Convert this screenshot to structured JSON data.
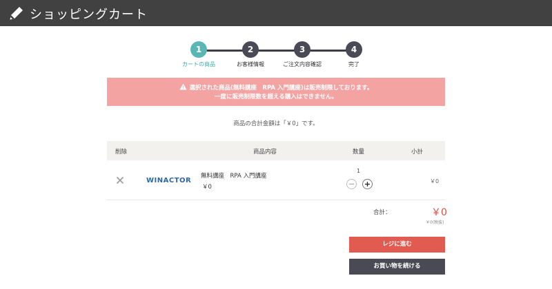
{
  "header": {
    "title": "ショッピングカート",
    "icon": "pencil-icon"
  },
  "steps": [
    {
      "num": "1",
      "label": "カートの商品",
      "active": true
    },
    {
      "num": "2",
      "label": "お客様情報",
      "active": false
    },
    {
      "num": "3",
      "label": "ご注文内容確認",
      "active": false
    },
    {
      "num": "4",
      "label": "完了",
      "active": false
    }
  ],
  "alert": {
    "line1": "選択された商品(無料講座　RPA 入門講座)は販売制限しております。",
    "line2": "一度に販売制限数を超える購入はできません。"
  },
  "summary": {
    "total_note": "商品の合計金額は「￥0」です。"
  },
  "cart": {
    "columns": {
      "remove": "削除",
      "item": "商品内容",
      "qty": "数量",
      "subtotal": "小計"
    },
    "items": [
      {
        "logo": "WINACTOR",
        "name": "無料講座　RPA 入門講座",
        "price": "￥0",
        "quantity": "1",
        "subtotal": "￥0"
      }
    ]
  },
  "totals": {
    "label": "合計：",
    "amount": "￥0",
    "tax_note": "￥0(税抜)"
  },
  "buttons": {
    "checkout": "レジに進む",
    "continue": "お買い物を続ける"
  },
  "colors": {
    "header_bg": "#414141",
    "accent_teal": "#59b6b2",
    "alert_bg": "#f4a3a3",
    "price_red": "#e04b3f",
    "checkout_bg": "#e15b50",
    "continue_bg": "#4a4a55"
  }
}
